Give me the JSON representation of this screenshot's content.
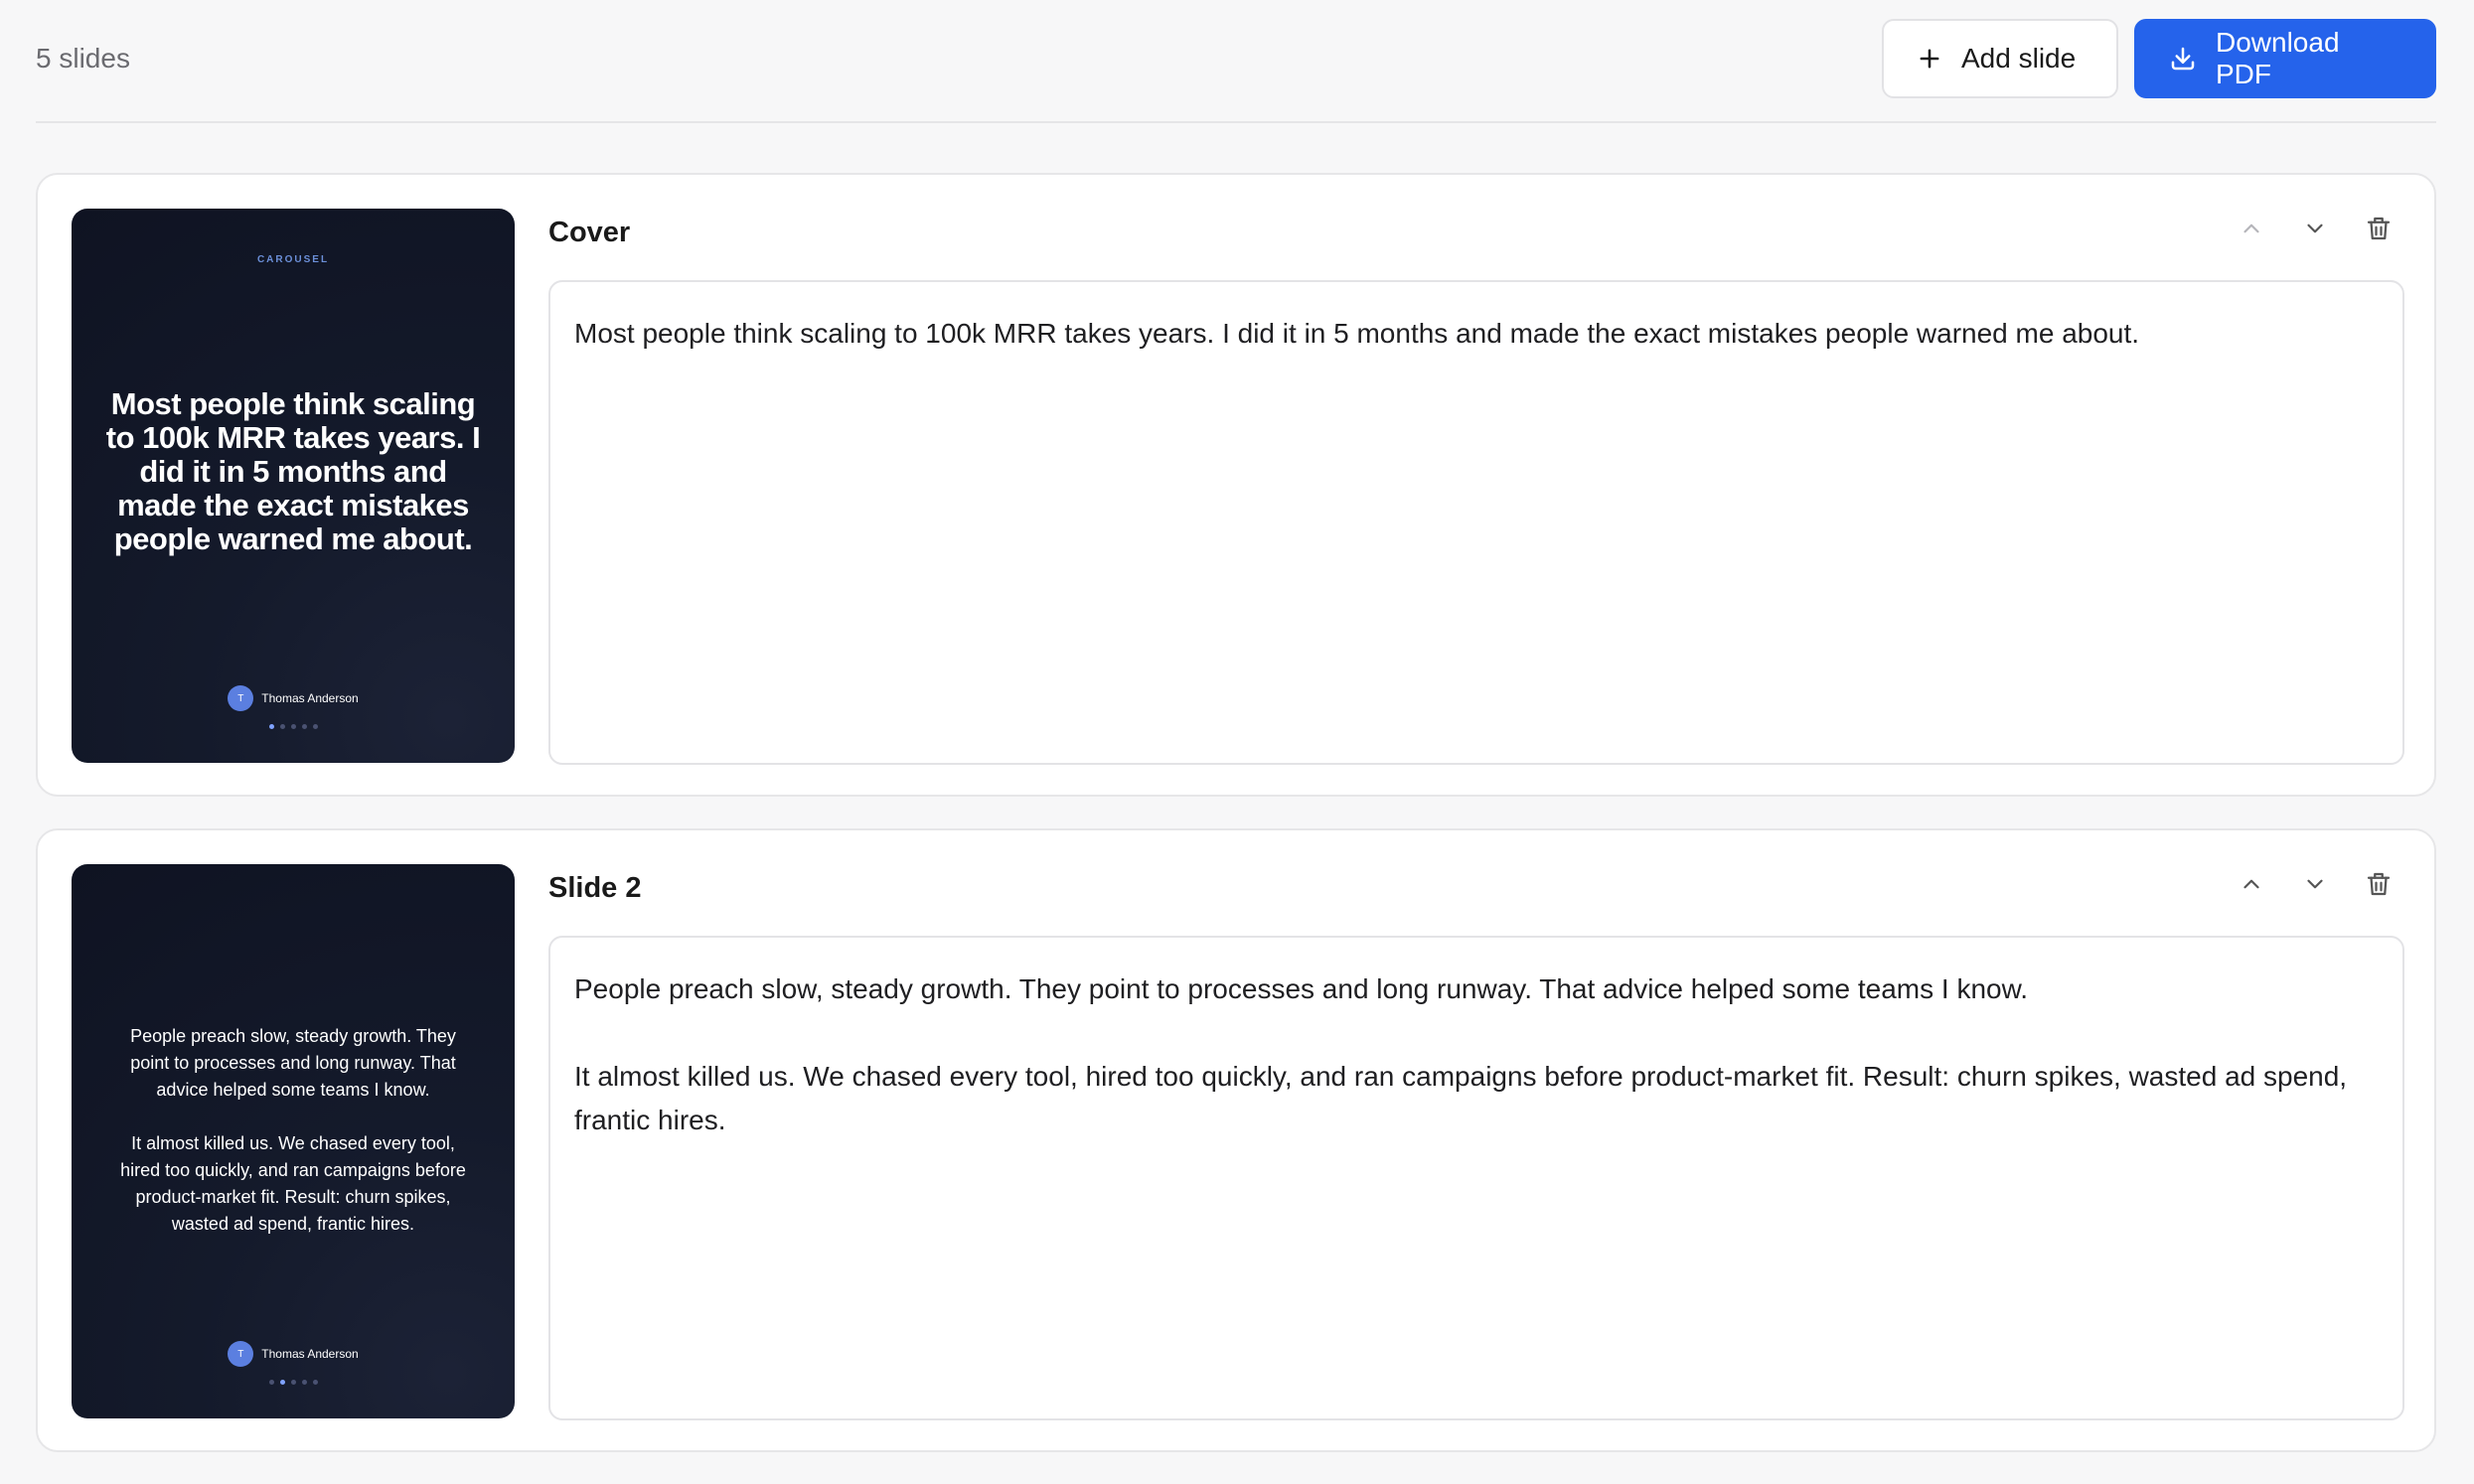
{
  "header": {
    "slide_count": "5 slides",
    "add_label": "Add slide",
    "download_label": "Download PDF"
  },
  "slides": [
    {
      "title": "Cover",
      "kicker": "CAROUSEL",
      "text": "Most people think scaling to 100k MRR takes years. I did it in 5 months and made the exact mistakes people warned me about.",
      "author": "Thomas Anderson",
      "avatar_initial": "T",
      "active_dot": 0
    },
    {
      "title": "Slide 2",
      "text": "People preach slow, steady growth. They point to processes and long runway. That advice helped some teams I know.\n\nIt almost killed us. We chased every tool, hired too quickly, and ran campaigns before product-market fit. Result: churn spikes, wasted ad spend, frantic hires.",
      "author": "Thomas Anderson",
      "avatar_initial": "T",
      "active_dot": 1
    }
  ],
  "colors": {
    "accent": "#2563eb",
    "slide_bg": "#0f1322",
    "avatar": "#5b7fe0"
  },
  "icons": [
    "plus-icon",
    "download-icon",
    "chevron-up-icon",
    "chevron-down-icon",
    "trash-icon"
  ]
}
